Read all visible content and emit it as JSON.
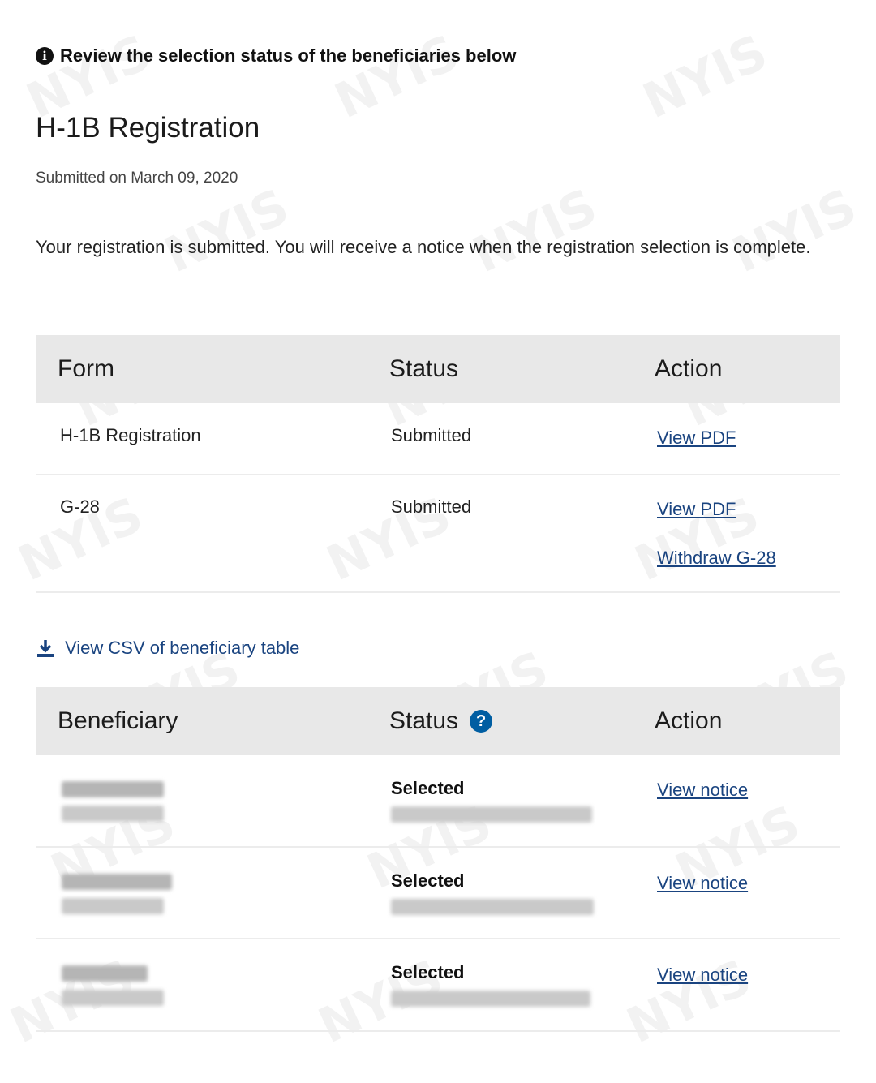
{
  "alert": {
    "icon": "info-icon",
    "text": "Review the selection status of the beneficiaries below"
  },
  "page_title": "H-1B Registration",
  "submitted_on": "Submitted on March 09, 2020",
  "message": "Your registration is submitted. You will receive a notice when the registration selection is complete.",
  "forms_table": {
    "headers": [
      "Form",
      "Status",
      "Action"
    ],
    "rows": [
      {
        "form": "H-1B Registration",
        "status": "Submitted",
        "actions": [
          "View PDF"
        ]
      },
      {
        "form": "G-28",
        "status": "Submitted",
        "actions": [
          "View PDF",
          "Withdraw G-28"
        ]
      }
    ]
  },
  "csv_link": {
    "icon": "download-icon",
    "label": "View CSV of beneficiary table"
  },
  "beneficiary_table": {
    "headers": [
      "Beneficiary",
      "Status",
      "Action"
    ],
    "status_help_icon": "question-circle-icon",
    "rows": [
      {
        "status": "Selected",
        "action": "View notice"
      },
      {
        "status": "Selected",
        "action": "View notice"
      },
      {
        "status": "Selected",
        "action": "View notice"
      }
    ]
  },
  "watermark_text": "NYIS",
  "colors": {
    "link": "#1a4480",
    "header_bg": "#e8e8e8",
    "help_icon": "#005ea2"
  }
}
